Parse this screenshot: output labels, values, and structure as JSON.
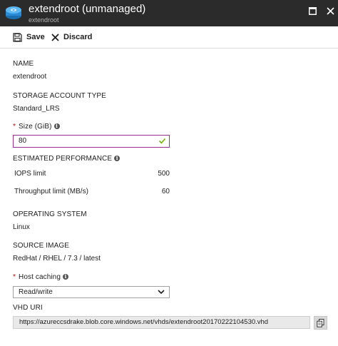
{
  "window": {
    "title": "extendroot (unmanaged)",
    "subtitle": "extendroot",
    "icon": "disk-icon"
  },
  "toolbar": {
    "save_label": "Save",
    "discard_label": "Discard"
  },
  "fields": {
    "name_label": "NAME",
    "name_value": "extendroot",
    "storage_label": "STORAGE ACCOUNT TYPE",
    "storage_value": "Standard_LRS",
    "size_required": "*",
    "size_label": "Size (GiB)",
    "size_value": "80",
    "perf_label": "ESTIMATED PERFORMANCE",
    "iops_label": "IOPS limit",
    "iops_value": "500",
    "throughput_label": "Throughput limit (MB/s)",
    "throughput_value": "60",
    "os_label": "OPERATING SYSTEM",
    "os_value": "Linux",
    "image_label": "SOURCE IMAGE",
    "image_value": "RedHat / RHEL / 7.3 / latest",
    "caching_required": "*",
    "caching_label": "Host caching",
    "caching_value": "Read/write",
    "vhd_label": "VHD URI",
    "vhd_value": "https://azureccsdrake.blob.core.windows.net/vhds/extendroot20170222104530.vhd"
  },
  "colors": {
    "titlebar": "#2b2b2b",
    "input_border_focus": "#9b2f8f",
    "valid_check": "#6bb700",
    "required": "#d60000"
  }
}
